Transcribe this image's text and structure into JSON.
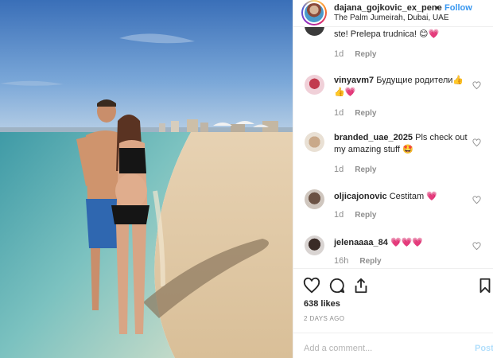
{
  "post": {
    "username": "dajana_gojkovic_ex_pene",
    "separator": "•",
    "follow_label": "Follow",
    "location": "The Palm Jumeirah, Dubai, UAE",
    "likes": "638 likes",
    "date": "2 DAYS AGO",
    "add_comment_placeholder": "Add a comment...",
    "post_label": "Post"
  },
  "comments": [
    {
      "text": "ste! Prelepa trudnica! 😊💗",
      "age": "1d",
      "reply": "Reply"
    },
    {
      "username": "vinyavm7",
      "text": "Будущие родители👍👍💗",
      "age": "1d",
      "reply": "Reply"
    },
    {
      "username": "branded_uae_2025",
      "text": "Pls check out my amazing stuff 🤩",
      "age": "1d",
      "reply": "Reply"
    },
    {
      "username": "oljicajonovic",
      "text": "Cestitam 💗",
      "age": "1d",
      "reply": "Reply"
    },
    {
      "username": "jelenaaaa_84",
      "text": "💗💗💗",
      "age": "16h",
      "reply": "Reply"
    }
  ],
  "icons": [
    "heart-icon",
    "comment-icon",
    "share-icon",
    "bookmark-icon"
  ],
  "colors": {
    "accent": "#3897f0",
    "muted": "#8e8e8e",
    "like": "#ed4956"
  }
}
